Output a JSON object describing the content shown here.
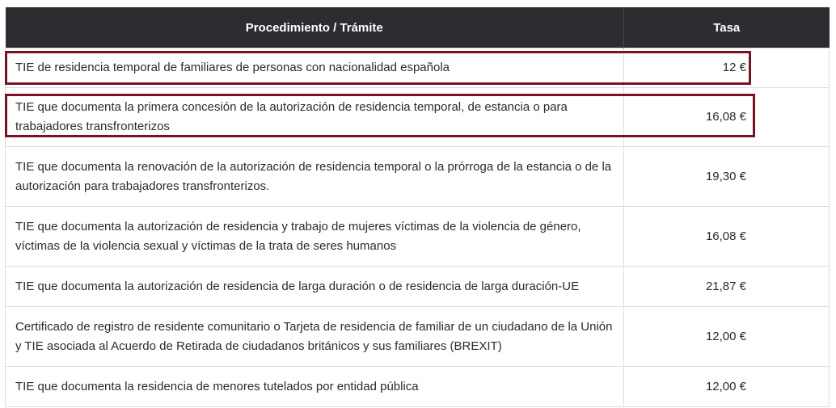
{
  "table": {
    "headers": [
      "Procedimiento / Trámite",
      "Tasa"
    ],
    "rows": [
      {
        "procedure": "TIE de residencia temporal de familiares de personas con nacionalidad española",
        "fee": "12 €",
        "highlighted": true
      },
      {
        "procedure": "TIE que documenta la primera concesión de la autorización de residencia temporal, de estancia o para trabajadores transfronterizos",
        "fee": "16,08 €",
        "highlighted": true
      },
      {
        "procedure": "TIE que documenta la renovación de la autorización de residencia temporal o la prórroga de la estancia o de la autorización para trabajadores transfronterizos.",
        "fee": "19,30 €",
        "highlighted": false
      },
      {
        "procedure": "TIE que documenta la autorización de residencia y trabajo de mujeres víctimas de la violencia de género, víctimas de la violencia sexual y víctimas de la trata de seres humanos",
        "fee": "16,08 €",
        "highlighted": false
      },
      {
        "procedure": "TIE que documenta la autorización de residencia de larga duración o de residencia de larga duración-UE",
        "fee": "21,87 €",
        "highlighted": false
      },
      {
        "procedure": "Certificado de registro de residente comunitario o Tarjeta de residencia de familiar de un ciudadano de la Unión y TIE asociada al Acuerdo de Retirada de ciudadanos británicos y sus familiares (BREXIT)",
        "fee": "12,00 €",
        "highlighted": false
      },
      {
        "procedure": "TIE que documenta la residencia de menores tutelados por entidad pública",
        "fee": "12,00 €",
        "highlighted": false
      }
    ]
  },
  "colors": {
    "header_bg": "#2c2d30",
    "highlight_border": "#7a1224",
    "row_border": "#dcdcdc"
  }
}
